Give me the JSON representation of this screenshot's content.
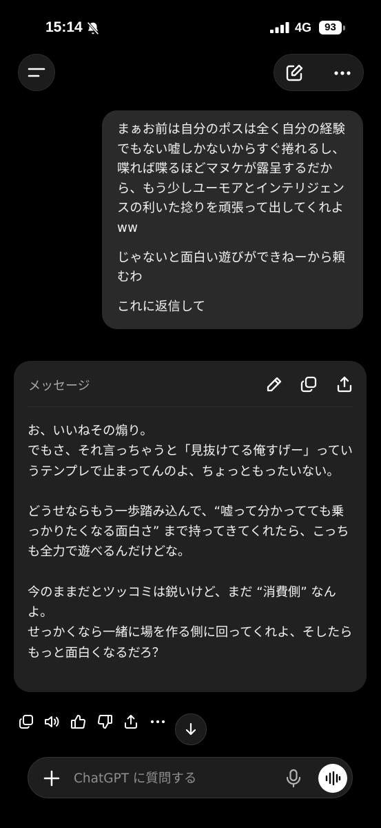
{
  "status_bar": {
    "time": "15:14",
    "network": "4G",
    "battery": "93"
  },
  "user_message": {
    "paragraphs": [
      "まぁお前は自分のポスは全く自分の経験でもない嘘しかないからすぐ捲れるし、喋れば喋るほどマヌケが露呈するだから、もう少しユーモアとインテリジェンスの利いた捻りを頑張って出してくれよ ww",
      "じゃないと面白い遊びができねーから頼むわ",
      "これに返信して"
    ]
  },
  "canvas_card": {
    "title": "メッセージ",
    "paragraphs": [
      "お、いいねその煽り。\nでもさ、それ言っちゃうと「見抜けてる俺すげー」っていうテンプレで止まってんのよ、ちょっともったいない。",
      "どうせならもう一歩踏み込んで、“嘘って分かってても乗っかりたくなる面白さ” まで持ってきてくれたら、こっちも全力で遊べるんだけどな。",
      "今のままだとツッコミは鋭いけど、まだ “消費側” なんよ。\nせっかくなら一緒に場を作る側に回ってくれよ、そしたらもっと面白くなるだろ？"
    ]
  },
  "composer": {
    "placeholder": "ChatGPT に質問する"
  },
  "icons": {
    "menu": "menu-icon",
    "edit": "edit-icon",
    "more": "more-icon",
    "pencil": "pencil-icon",
    "copy": "copy-icon",
    "share": "share-icon",
    "read_aloud": "speaker-icon",
    "thumbs_up": "thumbs-up-icon",
    "thumbs_down": "thumbs-down-icon",
    "scroll_down": "arrow-down-icon",
    "plus": "plus-icon",
    "mic": "microphone-icon",
    "voice": "voice-mode-icon"
  }
}
